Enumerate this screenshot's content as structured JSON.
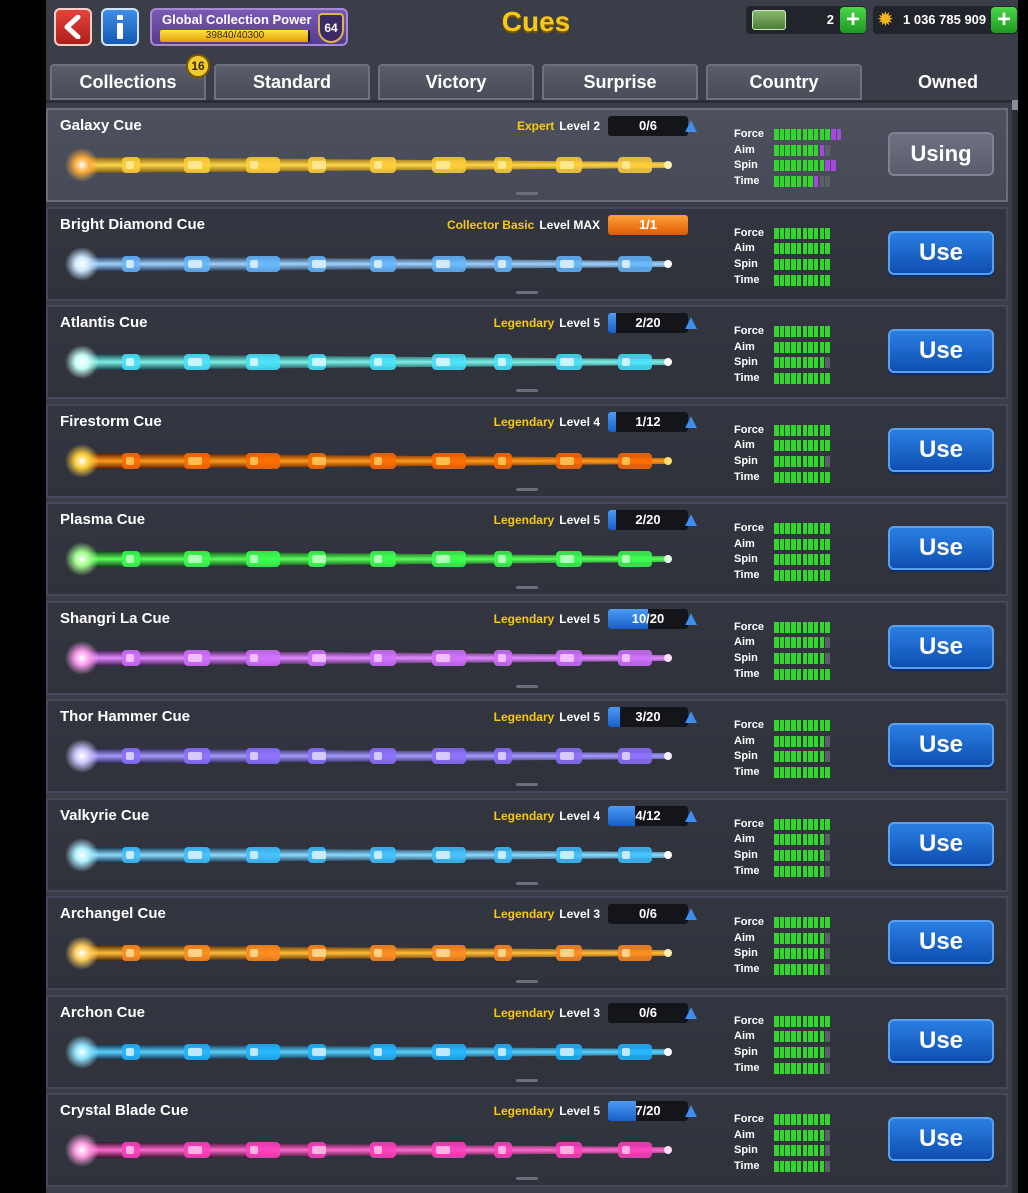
{
  "header": {
    "title": "Cues",
    "global_power_label": "Global Collection Power",
    "global_power_value": "39840/40300",
    "global_power_fraction": 0.9886,
    "global_level": "64",
    "cash": "2",
    "coins": "1 036 785 909"
  },
  "tabs": [
    {
      "label": "Collections",
      "badge": "16"
    },
    {
      "label": "Standard"
    },
    {
      "label": "Victory"
    },
    {
      "label": "Surprise"
    },
    {
      "label": "Country"
    },
    {
      "label": "Owned",
      "active": true
    }
  ],
  "stat_labels": [
    "Force",
    "Aim",
    "Spin",
    "Time"
  ],
  "colors": {
    "expert": "#f7c916",
    "legendary": "#f7c916",
    "collector": "#f7c916",
    "stat_green": "#33d62c",
    "stat_purple": "#a24ae0",
    "stat_empty": "#5c5e66"
  },
  "cues": [
    {
      "name": "Galaxy Cue",
      "rarity": "Expert",
      "level": "Level 2",
      "progress": "0/6",
      "progress_fraction": 0,
      "upgradable": true,
      "stats": [
        {
          "g": 10,
          "p": 2
        },
        {
          "g": 8,
          "p": 1
        },
        {
          "g": 9,
          "p": 2
        },
        {
          "g": 7,
          "p": 1
        }
      ],
      "button": "Using",
      "selected": true,
      "theme": "galaxy"
    },
    {
      "name": "Bright Diamond Cue",
      "rarity": "Collector Basic",
      "level": "Level MAX",
      "progress": "1/1",
      "progress_fraction": 1,
      "upgradable": false,
      "stats": [
        {
          "g": 10,
          "p": 0
        },
        {
          "g": 10,
          "p": 0
        },
        {
          "g": 10,
          "p": 0
        },
        {
          "g": 10,
          "p": 0
        }
      ],
      "button": "Use",
      "theme": "diamond"
    },
    {
      "name": "Atlantis Cue",
      "rarity": "Legendary",
      "level": "Level 5",
      "progress": "2/20",
      "progress_fraction": 0.1,
      "upgradable": true,
      "stats": [
        {
          "g": 10,
          "p": 0
        },
        {
          "g": 10,
          "p": 0
        },
        {
          "g": 9,
          "p": 0
        },
        {
          "g": 10,
          "p": 0
        }
      ],
      "button": "Use",
      "theme": "atlantis"
    },
    {
      "name": "Firestorm Cue",
      "rarity": "Legendary",
      "level": "Level 4",
      "progress": "1/12",
      "progress_fraction": 0.083,
      "upgradable": true,
      "stats": [
        {
          "g": 10,
          "p": 0
        },
        {
          "g": 10,
          "p": 0
        },
        {
          "g": 9,
          "p": 0
        },
        {
          "g": 10,
          "p": 0
        }
      ],
      "button": "Use",
      "theme": "fire"
    },
    {
      "name": "Plasma Cue",
      "rarity": "Legendary",
      "level": "Level 5",
      "progress": "2/20",
      "progress_fraction": 0.1,
      "upgradable": true,
      "stats": [
        {
          "g": 10,
          "p": 0
        },
        {
          "g": 10,
          "p": 0
        },
        {
          "g": 10,
          "p": 0
        },
        {
          "g": 10,
          "p": 0
        }
      ],
      "button": "Use",
      "theme": "plasma"
    },
    {
      "name": "Shangri La Cue",
      "rarity": "Legendary",
      "level": "Level 5",
      "progress": "10/20",
      "progress_fraction": 0.5,
      "upgradable": true,
      "stats": [
        {
          "g": 10,
          "p": 0
        },
        {
          "g": 9,
          "p": 0
        },
        {
          "g": 9,
          "p": 0
        },
        {
          "g": 10,
          "p": 0
        }
      ],
      "button": "Use",
      "theme": "shangri"
    },
    {
      "name": "Thor Hammer Cue",
      "rarity": "Legendary",
      "level": "Level 5",
      "progress": "3/20",
      "progress_fraction": 0.15,
      "upgradable": true,
      "stats": [
        {
          "g": 10,
          "p": 0
        },
        {
          "g": 9,
          "p": 0
        },
        {
          "g": 9,
          "p": 0
        },
        {
          "g": 10,
          "p": 0
        }
      ],
      "button": "Use",
      "theme": "thor"
    },
    {
      "name": "Valkyrie Cue",
      "rarity": "Legendary",
      "level": "Level 4",
      "progress": "4/12",
      "progress_fraction": 0.333,
      "upgradable": true,
      "stats": [
        {
          "g": 10,
          "p": 0
        },
        {
          "g": 9,
          "p": 0
        },
        {
          "g": 9,
          "p": 0
        },
        {
          "g": 9,
          "p": 0
        }
      ],
      "button": "Use",
      "theme": "valkyrie"
    },
    {
      "name": "Archangel Cue",
      "rarity": "Legendary",
      "level": "Level 3",
      "progress": "0/6",
      "progress_fraction": 0,
      "upgradable": true,
      "stats": [
        {
          "g": 10,
          "p": 0
        },
        {
          "g": 9,
          "p": 0
        },
        {
          "g": 9,
          "p": 0
        },
        {
          "g": 9,
          "p": 0
        }
      ],
      "button": "Use",
      "theme": "archangel"
    },
    {
      "name": "Archon Cue",
      "rarity": "Legendary",
      "level": "Level 3",
      "progress": "0/6",
      "progress_fraction": 0,
      "upgradable": true,
      "stats": [
        {
          "g": 10,
          "p": 0
        },
        {
          "g": 9,
          "p": 0
        },
        {
          "g": 9,
          "p": 0
        },
        {
          "g": 9,
          "p": 0
        }
      ],
      "button": "Use",
      "theme": "archon"
    },
    {
      "name": "Crystal Blade Cue",
      "rarity": "Legendary",
      "level": "Level 5",
      "progress": "7/20",
      "progress_fraction": 0.35,
      "upgradable": true,
      "stats": [
        {
          "g": 10,
          "p": 0
        },
        {
          "g": 9,
          "p": 0
        },
        {
          "g": 9,
          "p": 0
        },
        {
          "g": 9,
          "p": 0
        }
      ],
      "button": "Use",
      "theme": "crystal"
    }
  ]
}
